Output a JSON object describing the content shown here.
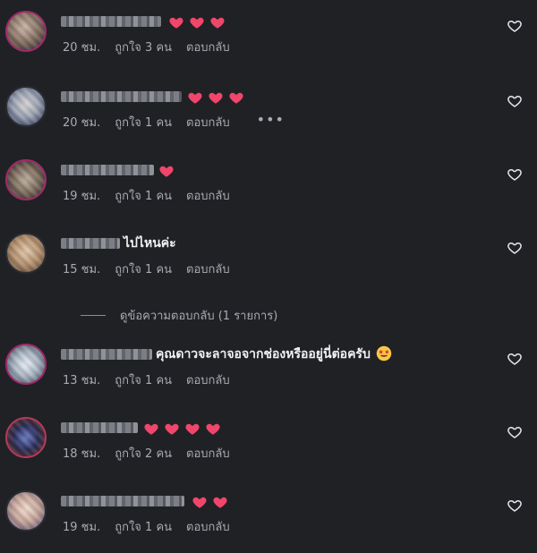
{
  "comments": [
    {
      "text": "",
      "hearts": 3,
      "time": "20 ชม.",
      "likes": "ถูกใจ 3 คน",
      "reply": "ตอบกลับ",
      "more": false
    },
    {
      "text": "",
      "hearts": 3,
      "time": "20 ชม.",
      "likes": "ถูกใจ 1 คน",
      "reply": "ตอบกลับ",
      "more": true
    },
    {
      "text": "",
      "hearts": 1,
      "time": "19 ชม.",
      "likes": "ถูกใจ 1 คน",
      "reply": "ตอบกลับ",
      "more": false
    },
    {
      "text": "ไปไหนค่ะ",
      "hearts": 0,
      "time": "15 ชม.",
      "likes": "ถูกใจ 1 คน",
      "reply": "ตอบกลับ",
      "more": false
    },
    {
      "text": "คุณดาวจะลาจอจากช่องหรืออยู่นี่ต่อครับ",
      "hearts": 0,
      "emoji": "star-struck-emoji",
      "time": "13 ชม.",
      "likes": "ถูกใจ 1 คน",
      "reply": "ตอบกลับ",
      "more": false
    },
    {
      "text": "",
      "hearts": 4,
      "time": "18 ชม.",
      "likes": "ถูกใจ 2 คน",
      "reply": "ตอบกลับ",
      "more": false
    },
    {
      "text": "",
      "hearts": 2,
      "time": "19 ชม.",
      "likes": "ถูกใจ 1 คน",
      "reply": "ตอบกลับ",
      "more": false
    }
  ],
  "view_replies": "ดูข้อความตอบกลับ (1 รายการ)",
  "icons": {
    "heart": "red-heart-emoji",
    "like": "heart-outline-icon",
    "more": "more-options-icon"
  },
  "colors": {
    "background": "#1f2125",
    "heart": "#f0466b",
    "meta": "#a8abb1"
  }
}
